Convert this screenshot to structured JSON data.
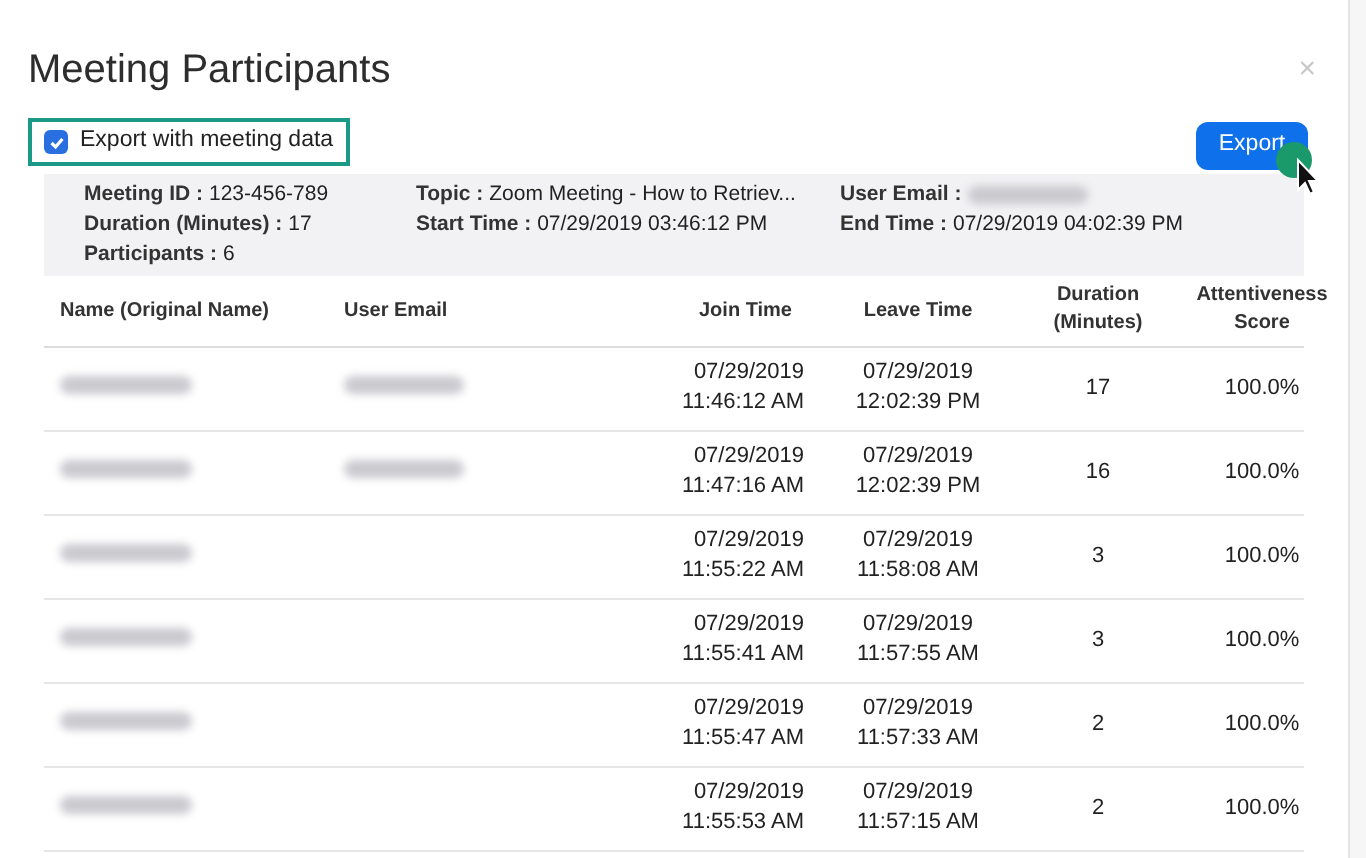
{
  "dialog": {
    "title": "Meeting Participants",
    "close": "×"
  },
  "export_option": {
    "label": "Export with meeting data",
    "checked": true
  },
  "export_button": "Export",
  "meeting_info": [
    {
      "label": "Meeting ID :",
      "value": "123-456-789"
    },
    {
      "label": "Topic :",
      "value": "Zoom Meeting - How to Retriev..."
    },
    {
      "label": "User Email :",
      "redacted": true
    },
    {
      "label": "Duration (Minutes) :",
      "value": "17"
    },
    {
      "label": "Start Time :",
      "value": "07/29/2019 03:46:12 PM"
    },
    {
      "label": "End Time :",
      "value": "07/29/2019 04:02:39 PM"
    },
    {
      "label": "Participants :",
      "value": "6"
    }
  ],
  "table": {
    "columns": [
      "Name (Original Name)",
      "User Email",
      "Join Time",
      "Leave Time",
      "Duration (Minutes)",
      "Attentiveness Score"
    ],
    "rows": [
      {
        "name_redacted": true,
        "email_redacted": true,
        "join": [
          "07/29/2019",
          "11:46:12 AM"
        ],
        "leave": [
          "07/29/2019",
          "12:02:39 PM"
        ],
        "duration": "17",
        "score": "100.0%"
      },
      {
        "name_redacted": true,
        "email_redacted": true,
        "join": [
          "07/29/2019",
          "11:47:16 AM"
        ],
        "leave": [
          "07/29/2019",
          "12:02:39 PM"
        ],
        "duration": "16",
        "score": "100.0%"
      },
      {
        "name_redacted": true,
        "email_redacted": false,
        "join": [
          "07/29/2019",
          "11:55:22 AM"
        ],
        "leave": [
          "07/29/2019",
          "11:58:08 AM"
        ],
        "duration": "3",
        "score": "100.0%"
      },
      {
        "name_redacted": true,
        "email_redacted": false,
        "join": [
          "07/29/2019",
          "11:55:41 AM"
        ],
        "leave": [
          "07/29/2019",
          "11:57:55 AM"
        ],
        "duration": "3",
        "score": "100.0%"
      },
      {
        "name_redacted": true,
        "email_redacted": false,
        "join": [
          "07/29/2019",
          "11:55:47 AM"
        ],
        "leave": [
          "07/29/2019",
          "11:57:33 AM"
        ],
        "duration": "2",
        "score": "100.0%"
      },
      {
        "name_redacted": true,
        "email_redacted": false,
        "join": [
          "07/29/2019",
          "11:55:53 AM"
        ],
        "leave": [
          "07/29/2019",
          "11:57:15 AM"
        ],
        "duration": "2",
        "score": "100.0%"
      }
    ]
  }
}
